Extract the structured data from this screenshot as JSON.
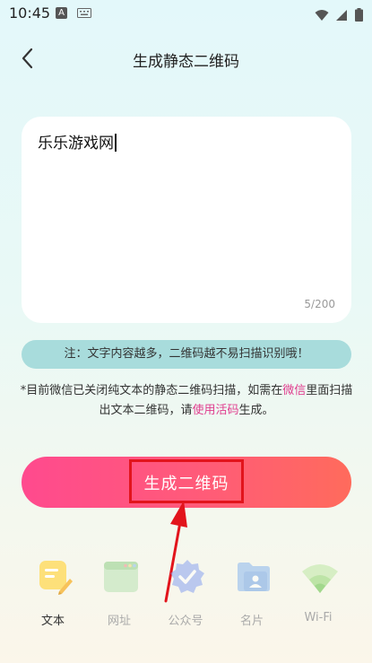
{
  "status_bar": {
    "time": "10:45",
    "notification_glyph": "A"
  },
  "header": {
    "title": "生成静态二维码"
  },
  "editor": {
    "text": "乐乐游戏网",
    "char_count": "5/200"
  },
  "note": "注：文字内容越多，二维码越不易扫描识别哦！",
  "info": {
    "part1": "*目前微信已关闭纯文本的静态二维码扫描，如需在",
    "link_wechat": "微信",
    "part2": "里面扫描出文本二维码，请",
    "link_live_code": "使用活码",
    "part3": "生成。"
  },
  "generate_button": {
    "label": "生成二维码"
  },
  "tabs": [
    {
      "label": "文本",
      "icon": "text-note-icon",
      "active": true
    },
    {
      "label": "网址",
      "icon": "browser-window-icon",
      "active": false
    },
    {
      "label": "公众号",
      "icon": "verified-badge-icon",
      "active": false
    },
    {
      "label": "名片",
      "icon": "contact-card-icon",
      "active": false
    },
    {
      "label": "Wi-Fi",
      "icon": "wifi-icon",
      "active": false
    }
  ],
  "colors": {
    "accent_pink": "#e03d8e",
    "button_gradient_start": "#ff4a8e",
    "button_gradient_end": "#ff6b5c",
    "note_bg": "#a8dcdc",
    "annotation_red": "#e2141c"
  }
}
